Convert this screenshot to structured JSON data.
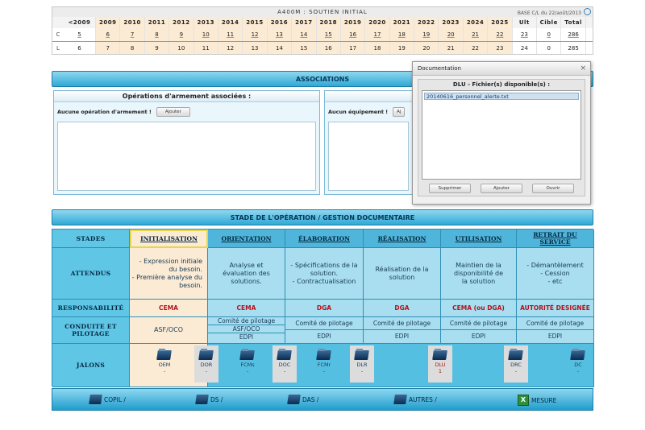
{
  "header": {
    "title": "A400M : SOUTIEN INITIAL",
    "base": "BASE C/L du 22/août/2013"
  },
  "years_table": {
    "columns": [
      "<2009",
      "2009",
      "2010",
      "2011",
      "2012",
      "2013",
      "2014",
      "2015",
      "2016",
      "2017",
      "2018",
      "2019",
      "2020",
      "2021",
      "2022",
      "2023",
      "2024",
      "2025",
      "Ult",
      "Cible",
      "Total"
    ],
    "rows": [
      {
        "label": "C",
        "values": [
          "5",
          "6",
          "7",
          "8",
          "9",
          "10",
          "11",
          "12",
          "13",
          "14",
          "15",
          "16",
          "17",
          "18",
          "19",
          "20",
          "21",
          "22",
          "23",
          "0",
          "286"
        ]
      },
      {
        "label": "L",
        "values": [
          "6",
          "7",
          "8",
          "9",
          "10",
          "11",
          "12",
          "13",
          "14",
          "15",
          "16",
          "17",
          "18",
          "19",
          "20",
          "21",
          "22",
          "23",
          "24",
          "0",
          "285"
        ]
      }
    ]
  },
  "associations": {
    "title": "ASSOCIATIONS",
    "panel_left": {
      "title": "Opérations d'armement associées :",
      "empty_text": "Aucune opération d'armement !",
      "add_label": "Ajouter"
    },
    "panel_right": {
      "empty_text": "Aucun équipement !",
      "add_label": "Aj"
    }
  },
  "dialog": {
    "title": "Documentation",
    "close": "×",
    "subtitle": "DLU - Fichier(s) disponible(s) :",
    "files": [
      "20140616_personnel_alerte.txt"
    ],
    "buttons": {
      "delete": "Supprimer",
      "add": "Ajouter",
      "open": "Ouvrir"
    }
  },
  "stage": {
    "title": "STADE DE L'OPÉRATION / GESTION DOCUMENTAIRE",
    "row_headers": {
      "stades": "STADES",
      "attendus": "ATTENDUS",
      "responsabilite": "RESPONSABILITÉ",
      "conduite": "CONDUITE ET PILOTAGE",
      "jalons": "JALONS"
    },
    "columns": [
      {
        "name": "INITIALISATION",
        "attendus": "- Expression initiale du besoin.\n- Première analyse du besoin.",
        "resp": "CEMA",
        "conduite": [
          "ASF/OCO"
        ]
      },
      {
        "name": "ORIENTATION",
        "attendus": "Analyse et évaluation des solutions.",
        "resp": "CEMA",
        "conduite": [
          "Comité de pilotage",
          "ASF/OCO",
          "EDPI"
        ]
      },
      {
        "name": "ÉLABORATION",
        "attendus": "- Spécifications de la solution.\n- Contractualisation",
        "resp": "DGA",
        "conduite": [
          "Comité de pilotage",
          "EDPI"
        ]
      },
      {
        "name": "RÉALISATION",
        "attendus": "Réalisation de la solution",
        "resp": "DGA",
        "conduite": [
          "Comité de pilotage",
          "EDPI"
        ]
      },
      {
        "name": "UTILISATION",
        "attendus": "Maintien de la disponibilité de la solution",
        "resp": "CEMA (ou DGA)",
        "conduite": [
          "Comité de pilotage",
          "EDPI"
        ]
      },
      {
        "name": "RETRAIT DU SERVICE",
        "attendus": "- Démantèlement\n- Cession\n- etc",
        "resp": "AUTORITÉ DESIGNÉE",
        "conduite": [
          "Comité de pilotage",
          "EDPI"
        ]
      }
    ],
    "milestones": [
      {
        "label": "OEM",
        "value": "-"
      },
      {
        "label": "DOR",
        "value": "-"
      },
      {
        "label": "FCMs",
        "value": "-"
      },
      {
        "label": "DOC",
        "value": "-"
      },
      {
        "label": "FCMr",
        "value": "-"
      },
      {
        "label": "DLR",
        "value": "-"
      },
      {
        "label": "DLU",
        "value": "1"
      },
      {
        "label": "DRC",
        "value": "-"
      },
      {
        "label": "DC",
        "value": "-"
      }
    ]
  },
  "footer": {
    "items": [
      "COPIL /",
      "DS /",
      "DAS /",
      "AUTRES /",
      "MESURE"
    ]
  }
}
